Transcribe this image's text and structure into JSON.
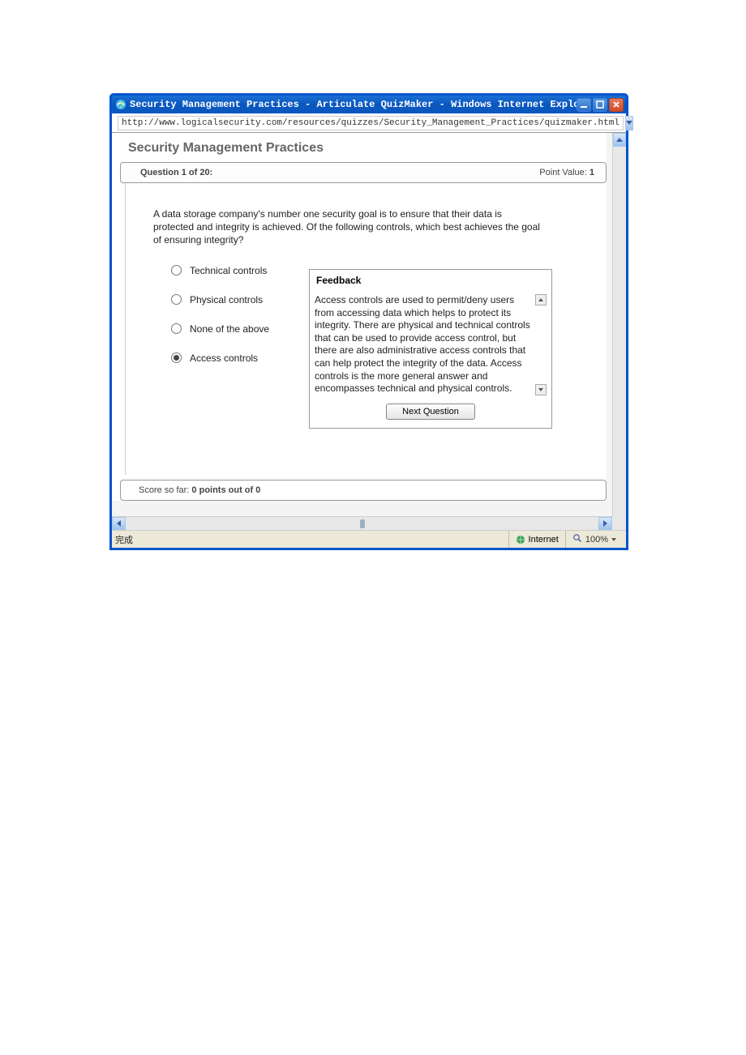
{
  "window": {
    "title": "Security Management Practices - Articulate QuizMaker - Windows Internet Explorer",
    "url": "http://www.logicalsecurity.com/resources/quizzes/Security_Management_Practices/quizmaker.html"
  },
  "quiz": {
    "title": "Security Management Practices",
    "question_label": "Question 1 of 20:",
    "point_label": "Point Value:",
    "point_value": "1",
    "question_text": "A data storage company's number one security goal is to ensure that their data is protected and integrity is achieved. Of the following controls, which best achieves the goal of ensuring integrity?",
    "options": [
      {
        "label": "Technical controls",
        "selected": false
      },
      {
        "label": "Physical controls",
        "selected": false
      },
      {
        "label": "None of the above",
        "selected": false
      },
      {
        "label": "Access controls",
        "selected": true
      }
    ],
    "feedback_title": "Feedback",
    "feedback_text": "Access controls are used to permit/deny users from accessing data which helps to protect its integrity. There are physical and technical controls that can be used to provide access control, but there are also administrative access controls that can help protect the integrity of the data. Access controls is the more general answer and encompasses technical and physical controls.",
    "next_button": "Next Question",
    "score_prefix": "Score so far: ",
    "score_value": "0 points out of 0"
  },
  "status": {
    "done": "完成",
    "zone": "Internet",
    "zoom": "100%"
  }
}
